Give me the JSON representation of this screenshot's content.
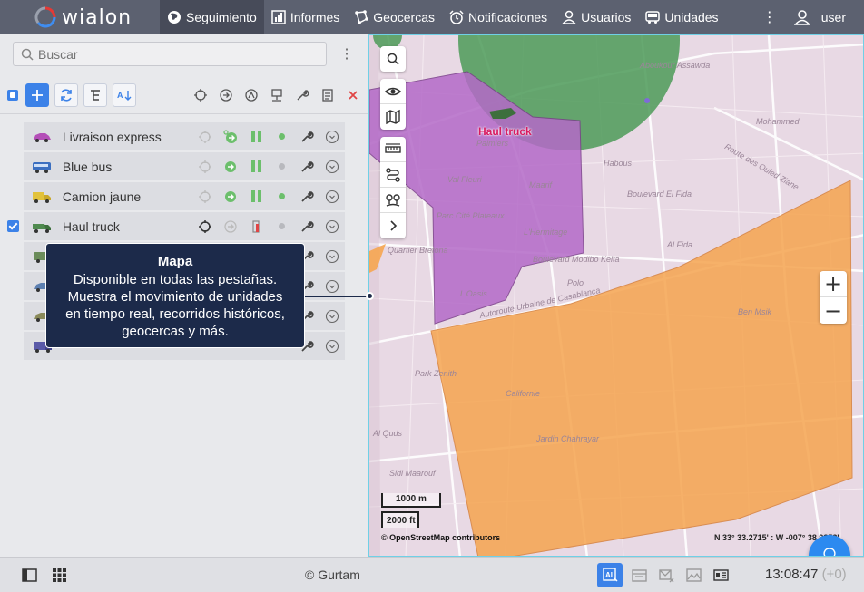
{
  "topbar": {
    "logo_text": "wialon",
    "nav": [
      {
        "label": "Seguimiento",
        "icon": "globe-icon",
        "active": true
      },
      {
        "label": "Informes",
        "icon": "bar-chart-icon",
        "active": false
      },
      {
        "label": "Geocercas",
        "icon": "geofence-icon",
        "active": false
      },
      {
        "label": "Notificaciones",
        "icon": "alarm-clock-icon",
        "active": false
      },
      {
        "label": "Usuarios",
        "icon": "user-icon",
        "active": false
      },
      {
        "label": "Unidades",
        "icon": "bus-icon",
        "active": false
      }
    ],
    "more_icon": "⋮",
    "user_name": "user"
  },
  "left_panel": {
    "search_placeholder": "Buscar",
    "units": [
      {
        "name": "Livraison express",
        "checked": false,
        "icon_color": "#b44fb8",
        "status_color": "#6cbf6c",
        "moving": true
      },
      {
        "name": "Blue bus",
        "checked": false,
        "icon_color": "#3b6fc0",
        "status_color": "#b8b9be",
        "moving": false
      },
      {
        "name": "Camion jaune",
        "checked": false,
        "icon_color": "#e2c23b",
        "status_color": "#6cbf6c",
        "moving": false
      },
      {
        "name": "Haul truck",
        "checked": true,
        "icon_color": "#4f8a4f",
        "status_color": "#b8b9be",
        "moving": false
      }
    ]
  },
  "tooltip": {
    "title": "Mapa",
    "lines": [
      "Disponible en todas las pestañas.",
      "Muestra el movimiento de unidades",
      "en tiempo real, recorridos históricos,",
      "geocercas y más."
    ]
  },
  "map": {
    "marker_label": "Haul truck",
    "scale_metric": "1000 m",
    "scale_imperial": "2000 ft",
    "attribution": "© OpenStreetMap contributors",
    "coordinates": "N 33° 33.2715' : W -007° 38.9853'",
    "zoom_in": "+",
    "zoom_out": "−",
    "street_labels": [
      {
        "text": "Palmiers"
      },
      {
        "text": "Val Fleuri"
      },
      {
        "text": "Parc Cité Plateaux"
      },
      {
        "text": "L'Hermitage"
      },
      {
        "text": "Maarif"
      },
      {
        "text": "Boulevard El Fida"
      },
      {
        "text": "Al Fida"
      },
      {
        "text": "Polo"
      },
      {
        "text": "L'Oasis"
      },
      {
        "text": "Park Zenith"
      },
      {
        "text": "Californie"
      },
      {
        "text": "Jardin Chahrayar"
      },
      {
        "text": "Sidi Maarouf"
      },
      {
        "text": "Al Quds"
      },
      {
        "text": "Ben Msik"
      },
      {
        "text": "Route des Ouled Ziane"
      },
      {
        "text": "Autoroute Urbaine de Casablanca"
      },
      {
        "text": "Habous"
      },
      {
        "text": "Aboukour Assawda"
      },
      {
        "text": "Mohammed"
      },
      {
        "text": "Boulevard Modibo Keita"
      },
      {
        "text": "Quartier Bretona"
      }
    ],
    "geofence_colors": {
      "orange": "#f6a550",
      "purple": "#b46ac8",
      "green": "#4c9a58"
    }
  },
  "bottombar": {
    "copyright": "© Gurtam",
    "time": "13:08:47",
    "tz": "(+0)"
  }
}
